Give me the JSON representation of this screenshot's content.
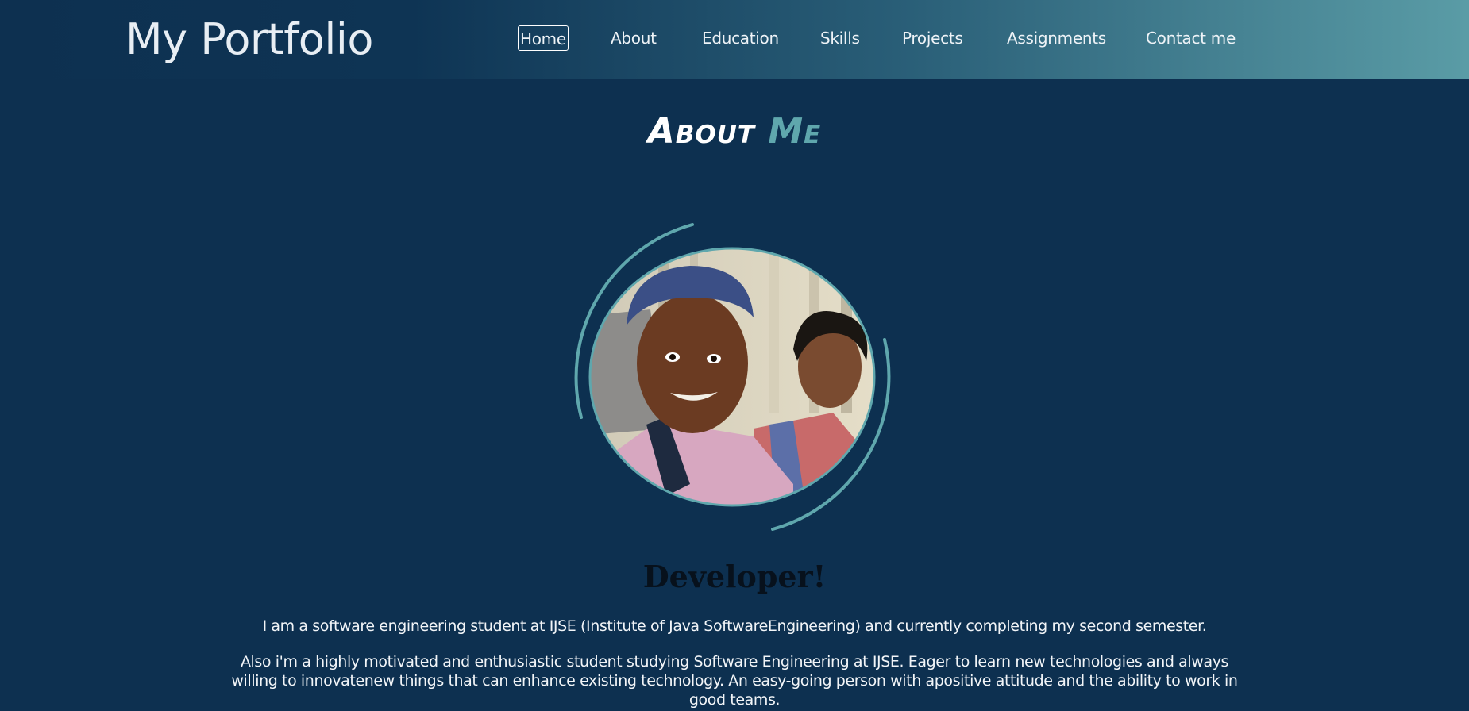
{
  "header": {
    "brand": "My Portfolio",
    "nav": [
      {
        "label": "Home",
        "active": true
      },
      {
        "label": "About",
        "active": false
      },
      {
        "label": "Education",
        "active": false
      },
      {
        "label": "Skills",
        "active": false
      },
      {
        "label": "Projects",
        "active": false
      },
      {
        "label": "Assignments",
        "active": false
      },
      {
        "label": "Contact me",
        "active": false
      }
    ]
  },
  "about": {
    "title_word1": "About",
    "title_word2": "Me",
    "role": "Developer!",
    "para1_before": "I am a software engineering student at ",
    "para1_link": "IJSE",
    "para1_after": " (Institute of Java SoftwareEngineering) and currently completing my second semester.",
    "para2": "Also i'm a highly motivated and enthusiastic student studying Software Engineering at IJSE. Eager to learn new technologies and always willing to innovatenew things that can enhance existing technology. An easy-going person with apositive attitude and the ability to work in good teams."
  },
  "colors": {
    "background": "#0d3050",
    "accent": "#5fa7ad",
    "header_gradient_end": "#5a9ca6"
  }
}
